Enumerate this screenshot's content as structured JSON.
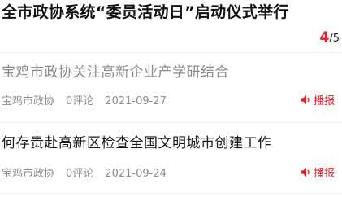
{
  "top_article": {
    "title": "全市政协系统“委员活动日”启动仪式举行",
    "pager_current": "4",
    "pager_total": "/5"
  },
  "news": [
    {
      "title": "宝鸡市政协关注高新企业产学研结合",
      "source": "宝鸡市政协",
      "comments": "0评论",
      "date": "2021-09-27",
      "broadcast_label": "播报"
    },
    {
      "title": "何存贵赴高新区检查全国文明城市创建工作",
      "source": "宝鸡市政协",
      "comments": "0评论",
      "date": "2021-09-24",
      "broadcast_label": "播报"
    }
  ],
  "colors": {
    "accent": "#d6232d",
    "read_title": "#8a8a8a",
    "meta": "#8c8c8c"
  },
  "icons": {
    "broadcast": "speaker-icon"
  }
}
